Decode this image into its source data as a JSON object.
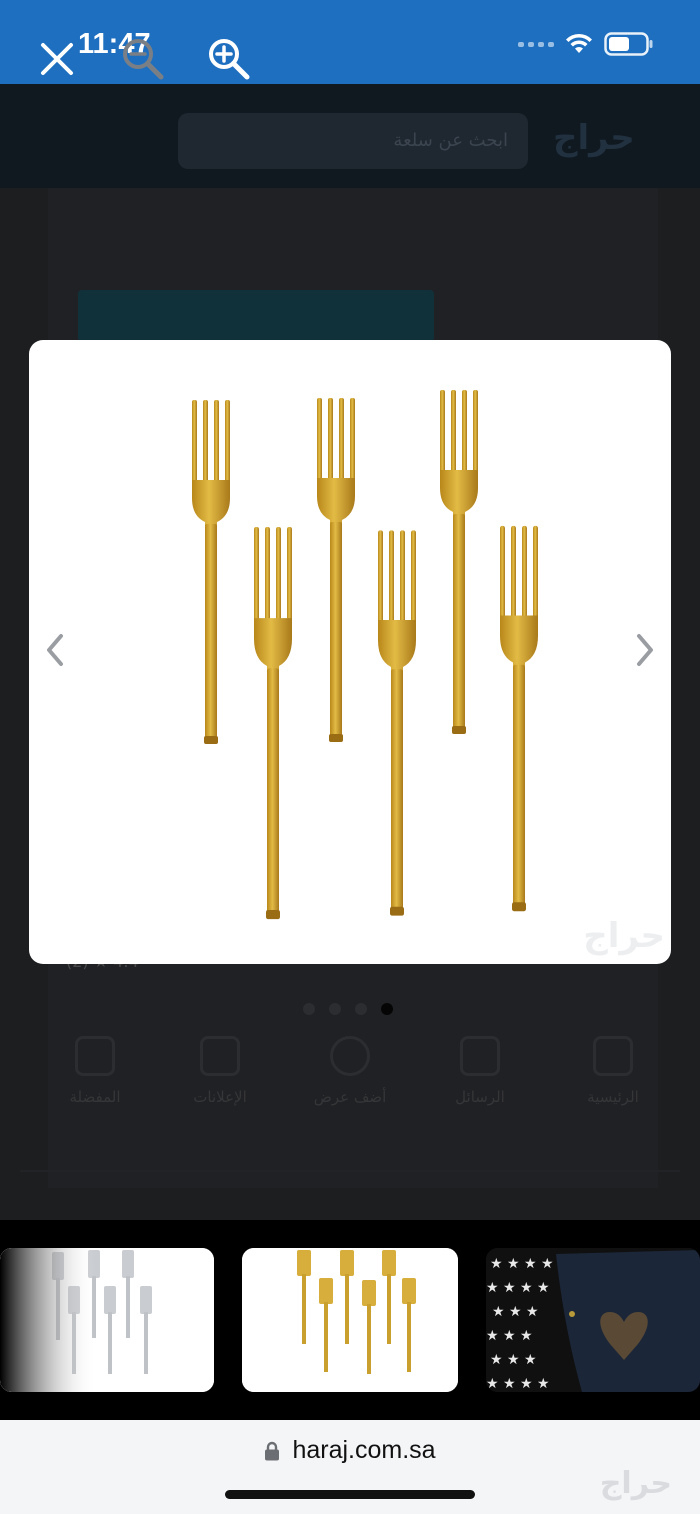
{
  "status_bar": {
    "time": "11:47",
    "icons": [
      "signal-dots",
      "wifi-icon",
      "battery-icon"
    ]
  },
  "toolbar": {
    "icons": [
      "close-icon",
      "zoom-out-icon",
      "zoom-in-icon"
    ]
  },
  "background_page": {
    "search_placeholder": "ابحث عن سلعة",
    "logo": "حراج",
    "rating_text": "(2) ★ 4.4",
    "pagination": {
      "total": 4,
      "active": 4
    },
    "nav_labels": [
      "الرئيسية",
      "الرسائل",
      "أضف عرض",
      "الإعلانات",
      "المفضلة"
    ]
  },
  "viewer": {
    "image": "gold-forks-set",
    "fork_count": 6,
    "watermark": "حراج",
    "prev_icon": "chevron-left-icon",
    "next_icon": "chevron-right-icon"
  },
  "thumbnails": [
    {
      "image": "silver-forks",
      "selected": false
    },
    {
      "image": "gold-forks",
      "selected": true
    },
    {
      "image": "black-heart-tray",
      "selected": false
    }
  ],
  "browser": {
    "url": "haraj.com.sa",
    "lock_icon": "lock-icon",
    "watermark": "حراج"
  },
  "colors": {
    "status_blue": "#1e6fc0",
    "gold": "#d4a82a",
    "toolbar_dark": "#101820"
  }
}
